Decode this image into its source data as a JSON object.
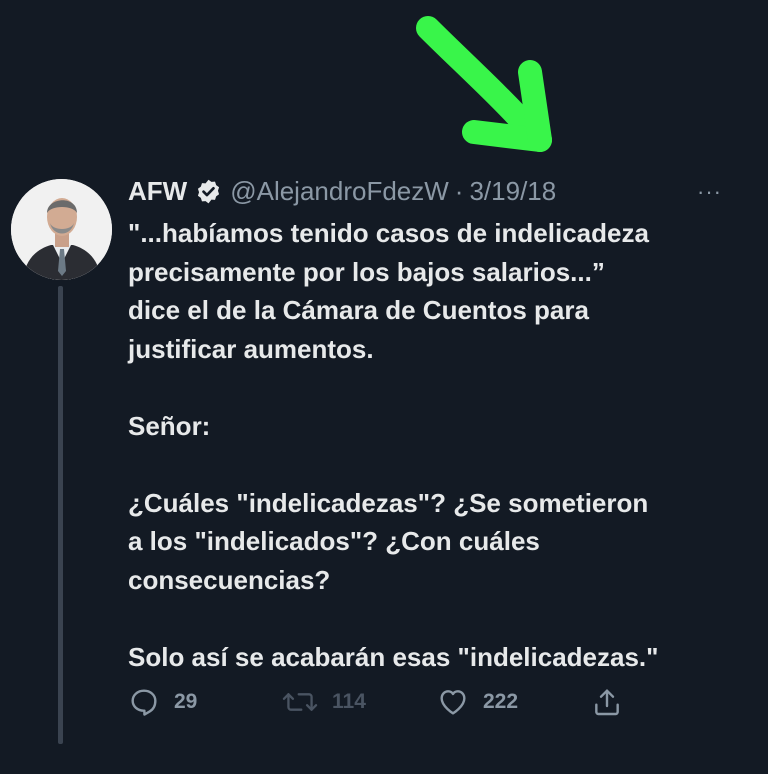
{
  "tweet": {
    "name": "AFW",
    "handle": "@AlejandroFdezW",
    "separator": "·",
    "date": "3/19/18",
    "more_label": "···",
    "lines": [
      "\"...habíamos tenido casos de indelicadeza",
      "precisamente por los bajos salarios...”",
      "dice el de la Cámara de Cuentos para",
      "justificar aumentos.",
      "",
      "Señor:",
      "",
      "¿Cuáles \"indelicadezas\"? ¿Se sometieron",
      "a los \"indelicados\"? ¿Con cuáles",
      "consecuencias?",
      "",
      "Solo así se acabarán esas \"indelicadezas.\""
    ]
  },
  "actions": {
    "replies": "29",
    "retweets": "114",
    "likes": "222"
  },
  "colors": {
    "background": "#131a24",
    "text": "#e7e9ea",
    "muted": "#8b98a5",
    "annotation_arrow": "#39f54a"
  },
  "icons": {
    "verified": "verified-badge-icon",
    "more": "more-options-icon",
    "reply": "reply-icon",
    "retweet": "retweet-icon",
    "like": "heart-icon",
    "share": "share-icon",
    "arrow": "green-arrow-annotation"
  }
}
